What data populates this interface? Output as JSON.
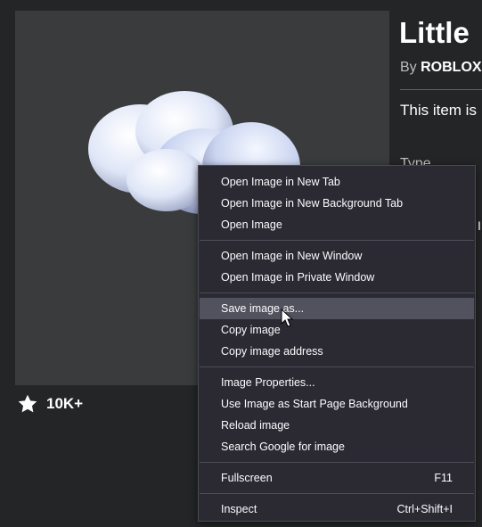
{
  "item": {
    "title": "Little",
    "by_prefix": "By",
    "creator": "ROBLOX",
    "description": "This item is",
    "type_label": "Type",
    "side_glyph": "I"
  },
  "favorites": {
    "count": "10K+",
    "icon": "star-icon"
  },
  "context_menu": {
    "items": [
      {
        "label": "Open Image in New Tab",
        "shortcut": ""
      },
      {
        "label": "Open Image in New Background Tab",
        "shortcut": ""
      },
      {
        "label": "Open Image",
        "shortcut": ""
      },
      {
        "label": "Open Image in New Window",
        "shortcut": ""
      },
      {
        "label": "Open Image in Private Window",
        "shortcut": ""
      },
      {
        "label": "Save image as...",
        "shortcut": ""
      },
      {
        "label": "Copy image",
        "shortcut": ""
      },
      {
        "label": "Copy image address",
        "shortcut": ""
      },
      {
        "label": "Image Properties...",
        "shortcut": ""
      },
      {
        "label": "Use Image as Start Page Background",
        "shortcut": ""
      },
      {
        "label": "Reload image",
        "shortcut": ""
      },
      {
        "label": "Search Google for image",
        "shortcut": ""
      },
      {
        "label": "Fullscreen",
        "shortcut": "F11"
      },
      {
        "label": "Inspect",
        "shortcut": "Ctrl+Shift+I"
      }
    ],
    "highlighted": "Save image as..."
  },
  "colors": {
    "page_bg": "#232527",
    "thumb_bg": "#393b3d",
    "menu_bg": "#2b2a33",
    "menu_hover": "#52525e"
  }
}
